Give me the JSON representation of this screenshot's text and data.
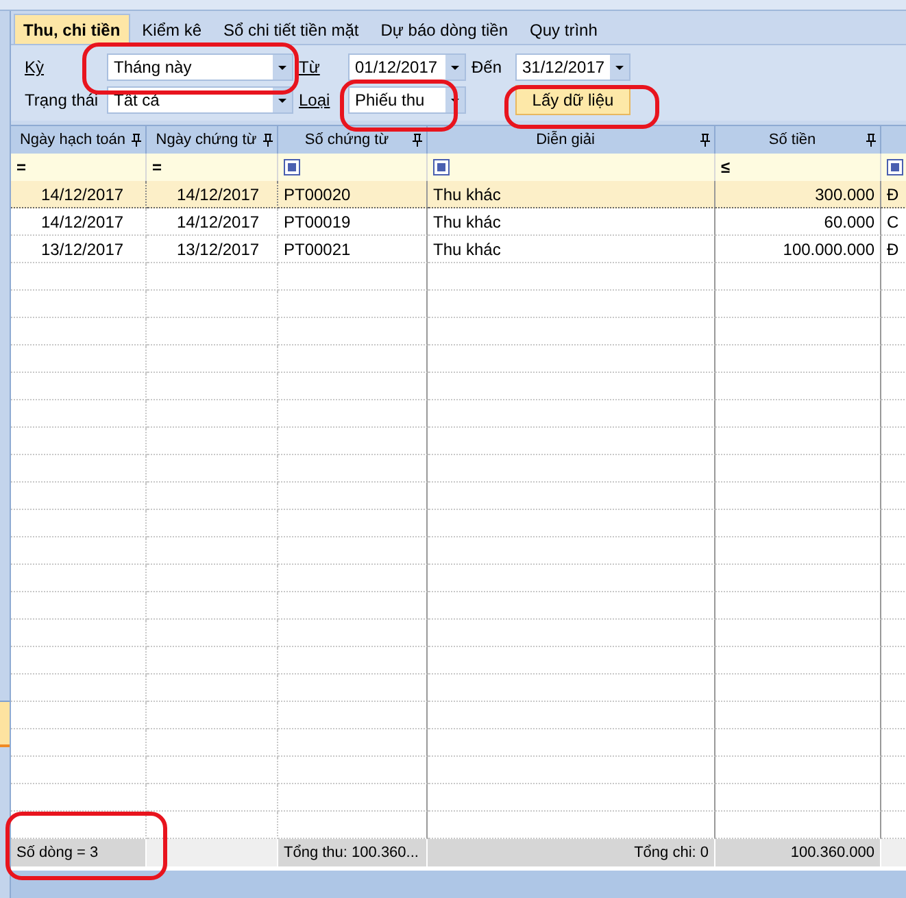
{
  "tabs": [
    {
      "label": "Thu, chi tiền",
      "selected": true
    },
    {
      "label": "Kiểm kê",
      "selected": false
    },
    {
      "label": "Sổ chi tiết tiền mặt",
      "selected": false
    },
    {
      "label": "Dự báo dòng tiền",
      "selected": false
    },
    {
      "label": "Quy trình",
      "selected": false
    }
  ],
  "filters": {
    "period_label": "Kỳ",
    "period": "Tháng này",
    "from_label": "Từ",
    "from": "01/12/2017",
    "to_label": "Đến",
    "to": "31/12/2017",
    "status_label": "Trạng thái",
    "status": "Tất cả",
    "type_label": "Loại",
    "type": "Phiếu thu",
    "fetch_button": "Lấy dữ liệu"
  },
  "table": {
    "columns": [
      {
        "label": "Ngày hạch toán",
        "kind": "date",
        "pinned": true
      },
      {
        "label": "Ngày chứng từ",
        "kind": "date",
        "pinned": true
      },
      {
        "label": "Số chứng từ",
        "kind": "text",
        "pinned": true
      },
      {
        "label": "Diễn giải",
        "kind": "text",
        "pinned": true
      },
      {
        "label": "Số tiền",
        "kind": "amount",
        "pinned": true
      },
      {
        "kind": "text",
        "pinned": false
      }
    ],
    "filter_row": [
      {
        "kind": "operator",
        "text": "="
      },
      {
        "kind": "operator",
        "text": "="
      },
      {
        "kind": "icon"
      },
      {
        "kind": "icon"
      },
      {
        "kind": "operator",
        "text": "≤"
      },
      {
        "kind": "icon"
      }
    ],
    "rows": [
      {
        "selected": true,
        "cells": [
          "14/12/2017",
          "14/12/2017",
          "PT00020",
          "Thu khác",
          "300.000",
          "Đ"
        ]
      },
      {
        "selected": false,
        "cells": [
          "14/12/2017",
          "14/12/2017",
          "PT00019",
          "Thu khác",
          "60.000",
          "C"
        ]
      },
      {
        "selected": false,
        "cells": [
          "13/12/2017",
          "13/12/2017",
          "PT00021",
          "Thu khác",
          "100.000.000",
          "Đ"
        ]
      }
    ],
    "footer": {
      "row_count": "Số dòng = 3",
      "total_in": "Tổng thu: 100.360...",
      "total_out": "Tổng chi: 0",
      "amount_total": "100.360.000"
    }
  }
}
